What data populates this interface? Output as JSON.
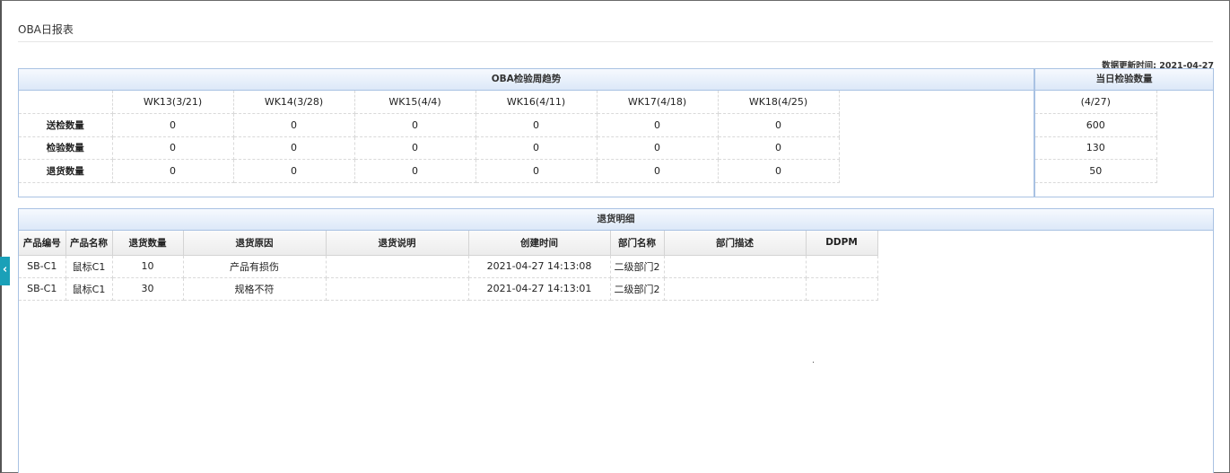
{
  "page": {
    "title": "OBA日报表"
  },
  "update": {
    "text": "数据更新时间: 2021-04-27"
  },
  "trend": {
    "header": "OBA检验周趋势",
    "weeks": [
      "WK13(3/21)",
      "WK14(3/28)",
      "WK15(4/4)",
      "WK16(4/11)",
      "WK17(4/18)",
      "WK18(4/25)"
    ],
    "rows": [
      {
        "label": "送检数量",
        "values": [
          "0",
          "0",
          "0",
          "0",
          "0",
          "0"
        ]
      },
      {
        "label": "检验数量",
        "values": [
          "0",
          "0",
          "0",
          "0",
          "0",
          "0"
        ]
      },
      {
        "label": "退货数量",
        "values": [
          "0",
          "0",
          "0",
          "0",
          "0",
          "0"
        ]
      }
    ]
  },
  "today": {
    "header": "当日检验数量",
    "date": "(4/27)",
    "values": [
      "600",
      "130",
      "50"
    ]
  },
  "returns": {
    "header": "退货明细",
    "columns": [
      "产品编号",
      "产品名称",
      "退货数量",
      "退货原因",
      "退货说明",
      "创建时间",
      "部门名称",
      "部门描述",
      "DDPM"
    ],
    "rows": [
      [
        "SB-C1",
        "鼠标C1",
        "10",
        "产品有损伤",
        "",
        "2021-04-27 14:13:08",
        "二级部门2",
        "",
        ""
      ],
      [
        "SB-C1",
        "鼠标C1",
        "30",
        "规格不符",
        "",
        "2021-04-27 14:13:01",
        "二级部门2",
        "",
        ""
      ]
    ]
  },
  "sidebar_toggle": {
    "icon": "chevron-left-icon",
    "glyph": "‹",
    "color": "#1aa0b8"
  },
  "colors": {
    "panel_border": "#a9c2e3",
    "header_gradient_bottom": "#dce8f8"
  }
}
